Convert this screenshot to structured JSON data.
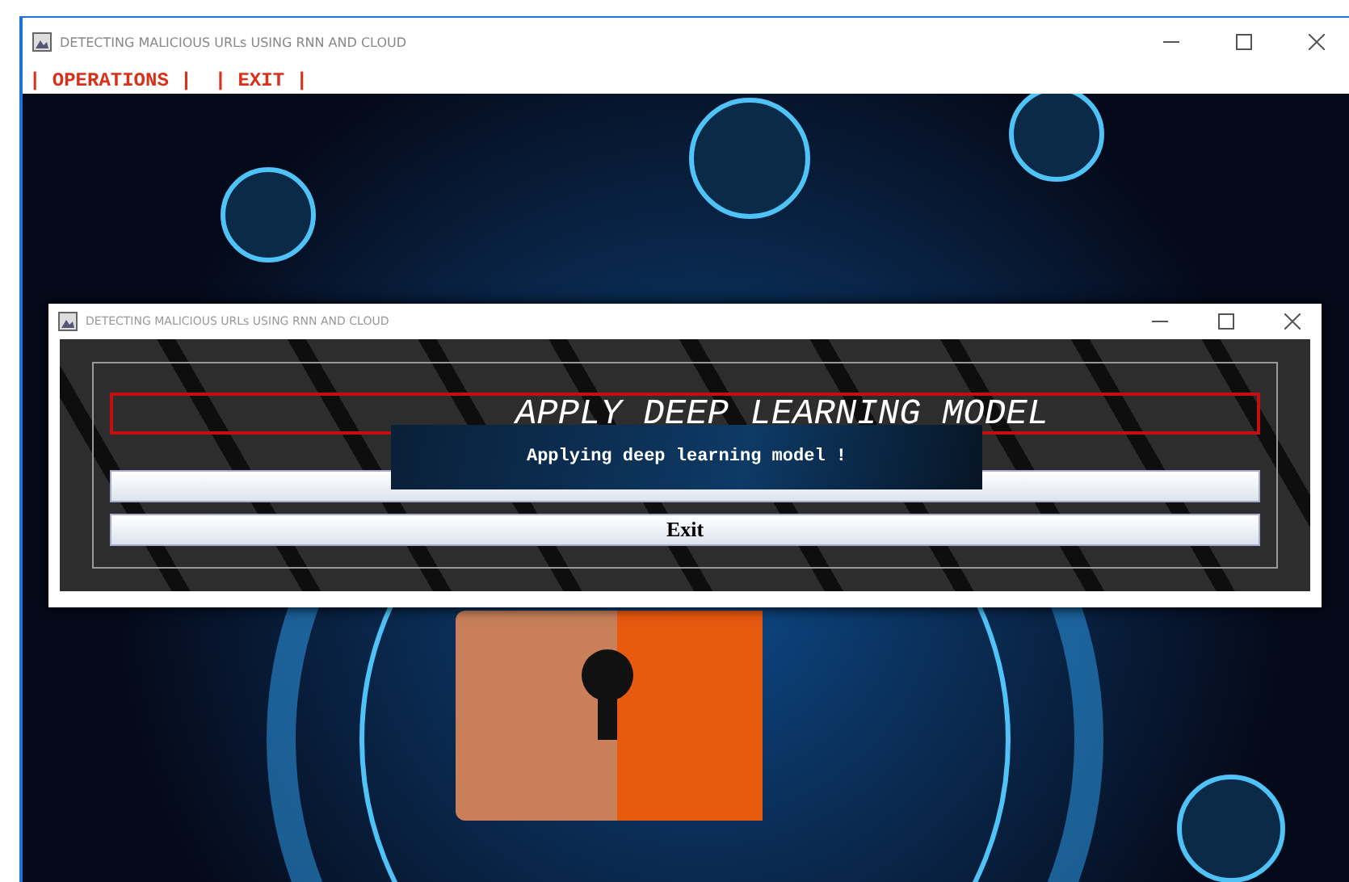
{
  "window": {
    "title": "DETECTING MALICIOUS URLs USING RNN AND CLOUD"
  },
  "menu": [
    {
      "label": "| OPERATIONS |"
    },
    {
      "label": "| EXIT |"
    }
  ],
  "dialog": {
    "title": "DETECTING MALICIOUS URLs USING RNN AND CLOUD",
    "heading": "APPLY DEEP LEARNING MODEL",
    "buttons": [
      {
        "kind": "covered"
      },
      {
        "kind": "labelled",
        "label": "Exit"
      }
    ]
  },
  "toast": {
    "message": "Applying deep learning model !"
  }
}
